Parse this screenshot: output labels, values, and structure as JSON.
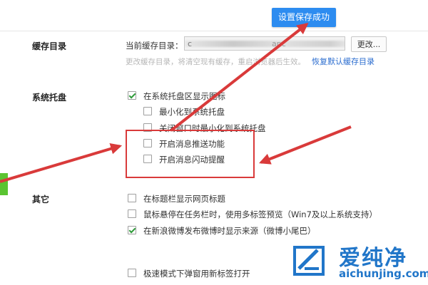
{
  "toast": {
    "text": "设置保存成功"
  },
  "cache": {
    "section_label": "缓存目录",
    "current_label": "当前缓存目录：",
    "path_prefix": "c",
    "path_visible": "apc",
    "change_button": "更改...",
    "hint": "更改缓存目录，将清空现有缓存，重启浏览器后生效。",
    "restore_link": "恢复默认缓存目录"
  },
  "tray": {
    "section_label": "系统托盘",
    "options": [
      {
        "label": "在系统托盘区显示图标",
        "checked": true
      },
      {
        "label": "最小化到系统托盘",
        "checked": false
      },
      {
        "label": "关闭窗口时最小化到系统托盘",
        "checked": false
      },
      {
        "label": "开启消息推送功能",
        "checked": false
      },
      {
        "label": "开启消息闪动提醒",
        "checked": false
      }
    ]
  },
  "other": {
    "section_label": "其它",
    "options": [
      {
        "label": "在标题栏显示网页标题",
        "checked": false
      },
      {
        "label": "鼠标悬停在任务栏时，使用多标签预览（Win7及以上系统支持）",
        "checked": false
      },
      {
        "label": "在新浪微博发布微博时显示来源（微博小尾巴）",
        "checked": true
      },
      {
        "label": "极速模式下弹窗用新标签打开",
        "checked": false
      }
    ]
  },
  "watermark": {
    "cn": "爱纯净",
    "url": "aichunjing.com"
  },
  "colors": {
    "accent": "#2d8cf0",
    "annotation_red": "#d93a3a",
    "check_green": "#2f9b3a",
    "brand_blue": "#2176c9"
  },
  "icons": [
    "checkbox-checked-icon",
    "checkbox-empty-icon",
    "aichunjing-logo-icon"
  ]
}
